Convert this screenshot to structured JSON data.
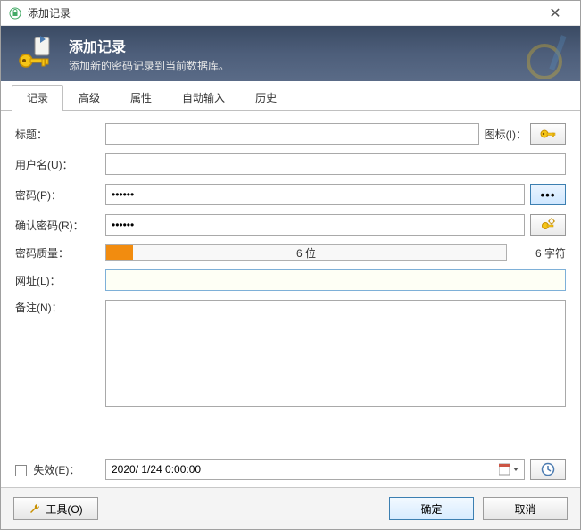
{
  "window": {
    "title": "添加记录"
  },
  "banner": {
    "title": "添加记录",
    "subtitle": "添加新的密码记录到当前数据库。"
  },
  "tabs": [
    "记录",
    "高级",
    "属性",
    "自动输入",
    "历史"
  ],
  "labels": {
    "title": "标题：",
    "iconLabel": "图标(I)：",
    "user": "用户名(U)：",
    "password": "密码(P)：",
    "confirm": "确认密码(R)：",
    "quality": "密码质量：",
    "qualityText": "6 位",
    "chars": "6 字符",
    "url": "网址(L)：",
    "notes": "备注(N)：",
    "expire": "失效(E)："
  },
  "values": {
    "title": "",
    "user": "",
    "password": "••••••",
    "confirm": "••••••",
    "url": "",
    "notes": "",
    "expireDate": "2020/ 1/24  0:00:00"
  },
  "footer": {
    "tools": "工具(O)",
    "ok": "确定",
    "cancel": "取消"
  },
  "colors": {
    "accent": "#3c7fb1",
    "meterFill": "#f28c0f"
  }
}
